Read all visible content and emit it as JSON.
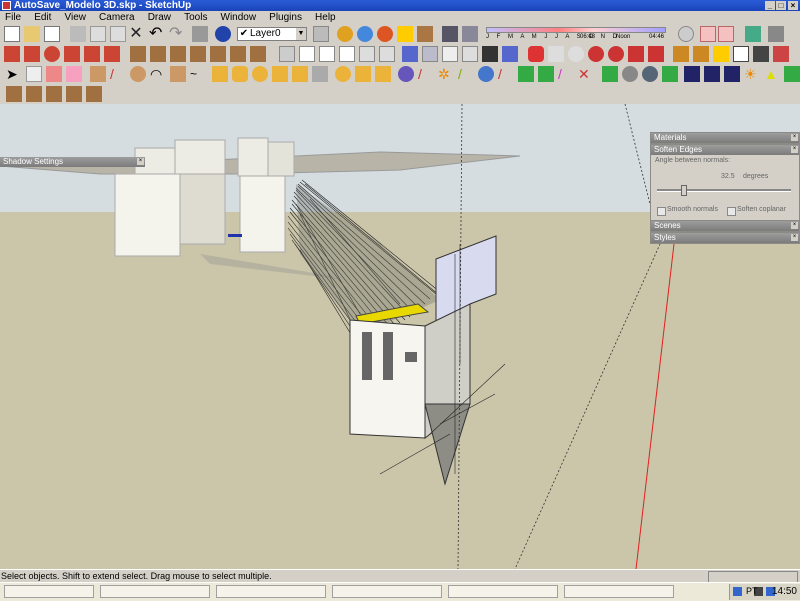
{
  "window": {
    "title": "AutoSave_Modelo 3D.skp - SketchUp"
  },
  "menu": [
    "File",
    "Edit",
    "View",
    "Camera",
    "Draw",
    "Tools",
    "Window",
    "Plugins",
    "Help"
  ],
  "toolbar": {
    "layer_select": "Layer0",
    "shadow": {
      "months": "J F M A M J J A S O N D",
      "time_start": "06:43",
      "noon": "Noon",
      "time_end": "04:46"
    }
  },
  "panels": {
    "materials": "Materials",
    "soften": {
      "title": "Soften Edges",
      "angle_label": "Angle between normals:",
      "angle_value": "32.5",
      "angle_unit": "degrees",
      "angle_fraction": 0.18,
      "smooth_normals": "Smooth normals",
      "soften_coplanar": "Soften coplanar"
    },
    "scenes": "Scenes",
    "styles": "Styles",
    "shadow_settings": "Shadow Settings"
  },
  "status": {
    "text": "Select objects. Shift to extend select. Drag mouse to select multiple."
  },
  "taskbar": {
    "clock": "14:50",
    "tray_label": "PT"
  },
  "colors": {
    "sky": "#d5dde0",
    "ground": "#cbc6aa",
    "titlebar": "#1f4fc8",
    "red_axis": "#e02020"
  },
  "icons": [
    "new-icon",
    "open-icon",
    "save-icon",
    "cut-icon",
    "copy-icon",
    "paste-icon",
    "erase-icon",
    "undo-icon",
    "redo-icon",
    "print-icon",
    "model-info-icon",
    "layer-icon",
    "component-icon",
    "paint-icon",
    "select-icon",
    "push-pull-icon",
    "rotate-icon",
    "orbit-icon",
    "zoom-icon",
    "walk-icon",
    "section-icon",
    "camera-icon",
    "soften-icon"
  ]
}
